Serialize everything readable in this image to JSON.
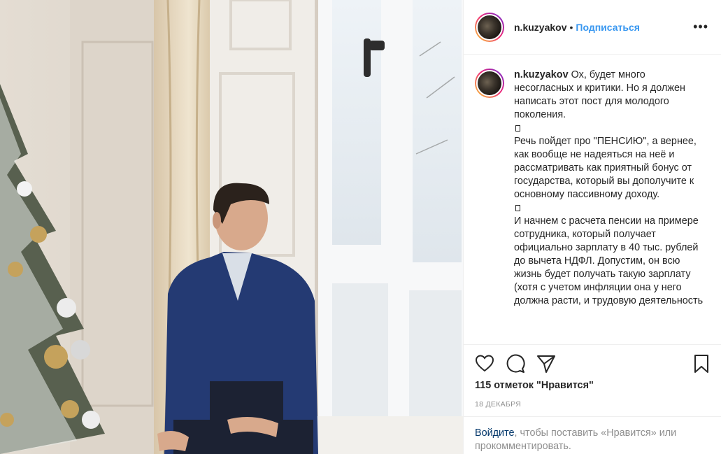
{
  "post": {
    "username": "n.kuzyakov",
    "separator": "•",
    "follow_label": "Подписаться",
    "more_label": "•••"
  },
  "caption": {
    "username": "n.kuzyakov",
    "lines": [
      "Ох, будет много несогласных и критики. Но я должен написать этот пост для молодого поколения.",
      "Речь пойдет про \"ПЕНСИЮ\", а вернее, как вообще не надеяться на неё и рассматривать как приятный бонус от государства, который вы дополучите к основному пассивному доходу.",
      "И начнем с расчета пенсии на примере сотрудника, который получает официально зарплату в 40 тыс. рублей до вычета НДФЛ. Допустим, он всю жизнь будет получать такую зарплату (хотя с учетом инфляции она у него должна расти, и трудовую деятельность"
    ]
  },
  "actions": {
    "icons": [
      "heart-icon",
      "comment-icon",
      "share-icon",
      "bookmark-icon"
    ],
    "likes_text": "115 отметок \"Нравится\"",
    "date_text": "18 ДЕКАБРЯ",
    "login_link": "Войдите",
    "login_rest": ", чтобы поставить «Нравится» или прокомментировать."
  },
  "colors": {
    "accent": "#3897f0",
    "link": "#003569",
    "muted": "#8e8e8e",
    "text": "#262626"
  }
}
